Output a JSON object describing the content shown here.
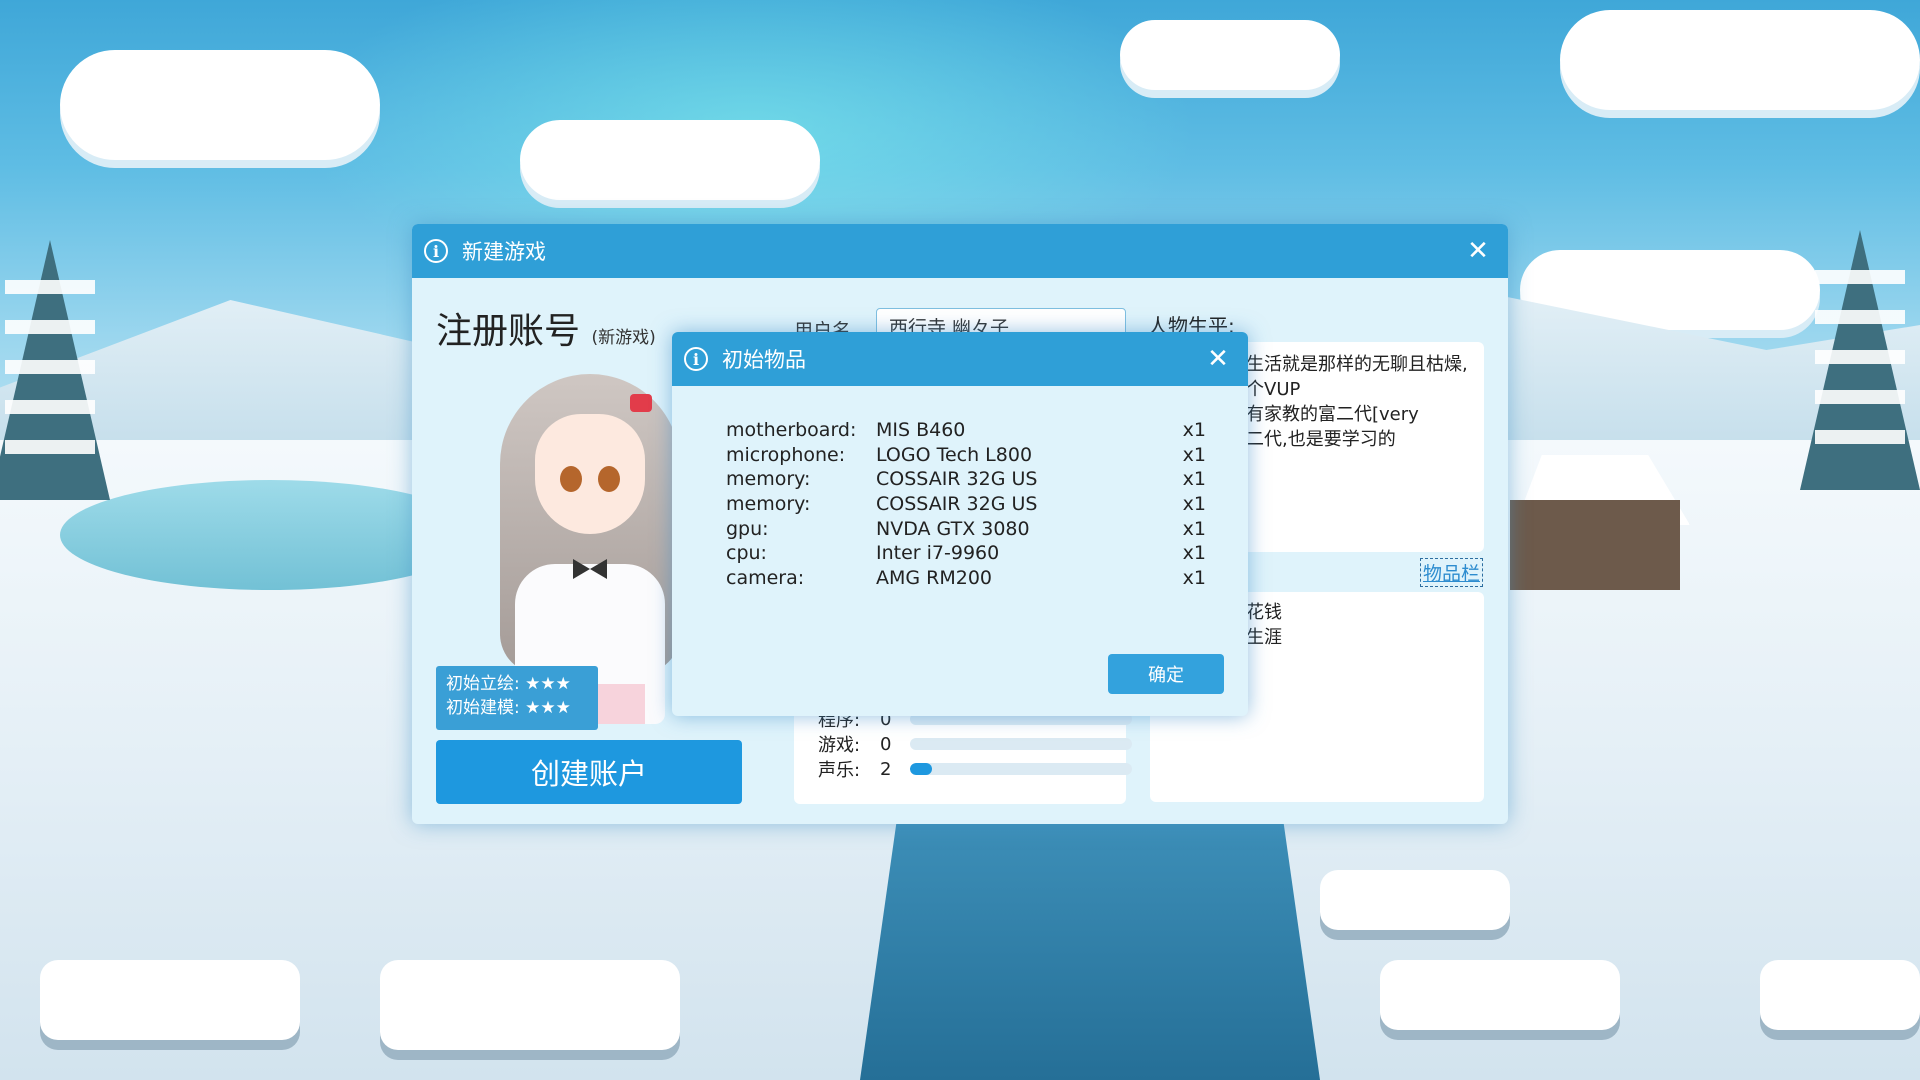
{
  "main_window": {
    "title": "新建游戏",
    "register_heading": "注册账号",
    "register_sub": "(新游戏)",
    "username_label": "用户名",
    "username_value": "西行寺 幽々子",
    "ratings": {
      "art_label": "初始立绘:",
      "art_stars": "★★★",
      "model_label": "初始建模:",
      "model_stars": "★★★"
    },
    "create_button": "创建账户",
    "stats": [
      {
        "label": "程序:",
        "value": 0,
        "fraction": 0.0
      },
      {
        "label": "游戏:",
        "value": 0,
        "fraction": 0.0
      },
      {
        "label": "声乐:",
        "value": 2,
        "fraction": 0.1
      }
    ],
    "bio_label": "人物生平:",
    "bio_lines": [
      "生活就是那样的无聊且枯燥,",
      "个VUP",
      "有家教的富二代[very",
      "",
      "二代,也是要学习的"
    ],
    "items_link": "物品栏",
    "items_lines": [
      "花钱",
      "生涯"
    ]
  },
  "dialog": {
    "title": "初始物品",
    "items": [
      {
        "type": "motherboard:",
        "name": "MIS B460",
        "qty": "x1"
      },
      {
        "type": "microphone:",
        "name": "LOGO Tech L800",
        "qty": "x1"
      },
      {
        "type": "memory:",
        "name": "COSSAIR 32G US",
        "qty": "x1"
      },
      {
        "type": "memory:",
        "name": "COSSAIR 32G US",
        "qty": "x1"
      },
      {
        "type": "gpu:",
        "name": "NVDA GTX 3080",
        "qty": "x1"
      },
      {
        "type": "cpu:",
        "name": "Inter i7-9960",
        "qty": "x1"
      },
      {
        "type": "camera:",
        "name": "AMG RM200",
        "qty": "x1"
      }
    ],
    "ok_button": "确定"
  },
  "icons": {
    "info": "info-icon",
    "close": "close-icon"
  },
  "colors": {
    "accent": "#2f9fd7",
    "button": "#1e98df",
    "panel": "#dff3fb"
  }
}
